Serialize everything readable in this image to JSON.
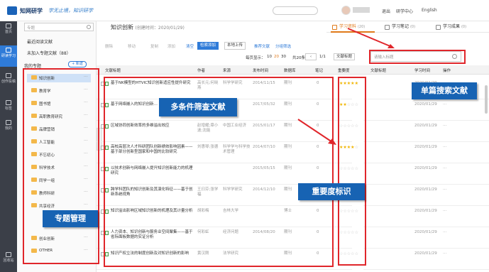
{
  "app": {
    "name": "知网研学",
    "slogan": "学无止境，知识研学"
  },
  "topbar": {
    "links": [
      "退出",
      "研学中心",
      "English"
    ]
  },
  "leftnav": [
    {
      "label": "首页"
    },
    {
      "label": "研读学习",
      "active": true
    },
    {
      "label": "创作投稿"
    },
    {
      "label": "标签"
    },
    {
      "label": "我的"
    },
    {
      "label": "回收站"
    }
  ],
  "sidebar": {
    "search_placeholder": "专题",
    "links": [
      "最近阅读文献",
      "未加入专题文献（88）",
      "我的专题"
    ],
    "new_button": "+ 新建",
    "tree": [
      "知识创新",
      "教育学",
      "图书馆",
      "高职教育研究",
      "品牌营销",
      "人工智能",
      "不忘初心",
      "科学技术",
      "同学一组",
      "教师科研",
      "共享经济",
      "创业创新",
      "OTHER"
    ]
  },
  "main": {
    "title": "知识创新",
    "title_sub": "(创建时间：2020/01/29)",
    "tabs": [
      {
        "label": "学习资料",
        "count": "(20)",
        "active": true
      },
      {
        "label": "学习笔记",
        "count": "(0)"
      },
      {
        "label": "学习成果",
        "count": "(0)"
      }
    ],
    "toolbar": {
      "faded": [
        "删除",
        "移动",
        "复制",
        "添加"
      ],
      "clear": "清空",
      "add_doc": "检索添加",
      "upload": "本地上传",
      "recommend": "推荐文献",
      "group": "分组筛选",
      "order": "文献标题"
    },
    "pager": {
      "label": "每页显示：",
      "sizes": [
        "10",
        "20",
        "30"
      ],
      "current": "20",
      "total": "共20条",
      "page": "1/1"
    },
    "right_search_placeholder": "请输入标题",
    "columns": [
      "文献标题",
      "作者",
      "来源",
      "发布时间",
      "数据库",
      "笔记",
      "重要度"
    ],
    "right_columns": [
      "文献标题",
      "学习时间",
      "操作"
    ],
    "rows": [
      {
        "title": "基于NK模型的HTVIC知识创新适应性提升研究",
        "author": "高长元;何晓燕",
        "source": "科学学研究",
        "date": "2014/11/15",
        "db": "期刊",
        "note": "0",
        "stars": 5
      },
      {
        "title": "基于网络嵌入的知识创新…",
        "author": "",
        "source": "",
        "date": "2017/05/32",
        "db": "期刊",
        "note": "0",
        "stars": 2
      },
      {
        "title": "区域协同创新效率的多维溢出效应",
        "author": "赵增耀;章小波;沈能",
        "source": "中国工业经济",
        "date": "2015/01/17",
        "db": "期刊",
        "note": "0",
        "stars": 0
      },
      {
        "title": "高校高层次人才科研团队创新绩效影响因素——基于部分创新型国家和中国的比较研究",
        "author": "刘惠琴;张德",
        "source": "科学学与科学技术管理",
        "date": "2014/07/10",
        "db": "期刊",
        "note": "0",
        "stars": 4
      },
      {
        "title": "以技术创新与网络嵌入提升知识创新能力的机理研究",
        "author": "",
        "source": "",
        "date": "2015/05/15",
        "db": "期刊",
        "note": "0",
        "stars": 0
      },
      {
        "title": "跨学科团队的知识创新及其演化特征——基于创新系统视角",
        "author": "王曰芬;张学福",
        "source": "科学学研究",
        "date": "2014/12/10",
        "db": "期刊",
        "note": "0",
        "stars": 0
      },
      {
        "title": "知识溢出影响区域知识创新的机理及其计量分析",
        "author": "胡彩梅",
        "source": "吉林大学",
        "date": "",
        "db": "博士",
        "note": "0",
        "stars": 0
      },
      {
        "title": "人力资本、知识创新与服务业空间聚集——基于省际面板数据的实证分析",
        "author": "何彩虹",
        "source": "经济问题",
        "date": "2014/08/20",
        "db": "期刊",
        "note": "0",
        "stars": 0
      },
      {
        "title": "知识产权立法的制度创新及对知识创新的影响",
        "author": "黄汉刚",
        "source": "法学研究",
        "date": "",
        "db": "期刊",
        "note": "0",
        "stars": 0
      }
    ],
    "right_rows": [
      "2020/01/29",
      "2020/01/29",
      "2020/01/29",
      "2020/01/29",
      "2020/01/29",
      "2020/01/29",
      "2020/01/29",
      "2020/01/29",
      "2020/01/29"
    ]
  },
  "callouts": {
    "sidebar": "专题管理",
    "filter": "多条件筛查文献",
    "importance": "重要度标识",
    "search": "单篇搜索文献"
  },
  "colors": {
    "accent": "#2f7bd8",
    "callout": "#1763b3",
    "annot": "#e0262b",
    "star": "#f0b400"
  }
}
